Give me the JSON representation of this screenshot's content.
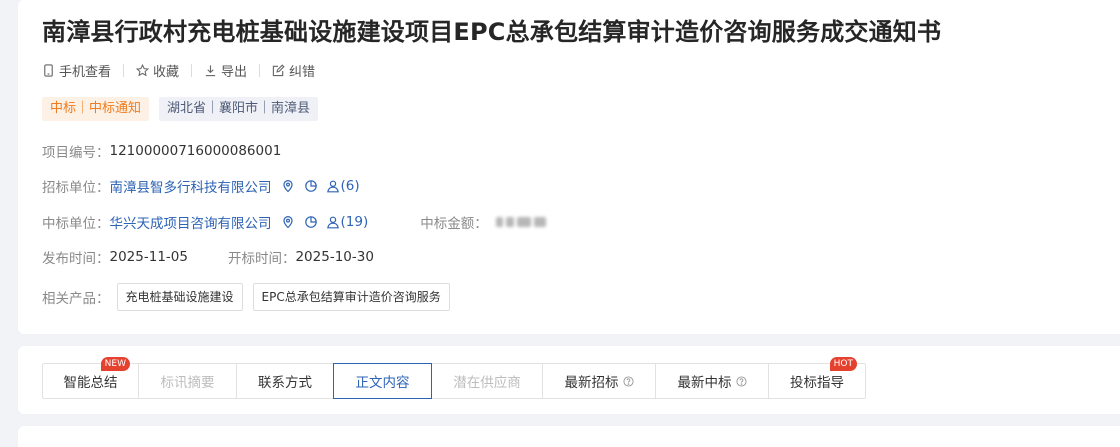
{
  "header": {
    "title": "南漳县行政村充电桩基础设施建设项目EPC总承包结算审计造价咨询服务成交通知书"
  },
  "actions": [
    {
      "label": "手机查看",
      "icon": "mobile-icon"
    },
    {
      "label": "收藏",
      "icon": "star-icon"
    },
    {
      "label": "导出",
      "icon": "download-icon"
    },
    {
      "label": "纠错",
      "icon": "edit-icon"
    }
  ],
  "tags": {
    "type": "中标｜中标通知",
    "region": "湖北省｜襄阳市｜南漳县"
  },
  "details": {
    "project_no_label": "项目编号：",
    "project_no": "12100000716000086001",
    "tenderer_label": "招标单位：",
    "tenderer": "南漳县智多行科技有限公司",
    "tenderer_contacts": "(6)",
    "winner_label": "中标单位：",
    "winner": "华兴天成项目咨询有限公司",
    "winner_contacts": "(19)",
    "amount_label": "中标金额：",
    "publish_label": "发布时间：",
    "publish_date": "2025-11-05",
    "open_label": "开标时间：",
    "open_date": "2025-10-30",
    "products_label": "相关产品：",
    "products": [
      "充电桩基础设施建设",
      "EPC总承包结算审计造价咨询服务"
    ]
  },
  "tabs": [
    {
      "label": "智能总结",
      "badge": "NEW"
    },
    {
      "label": "标讯摘要"
    },
    {
      "label": "联系方式"
    },
    {
      "label": "正文内容"
    },
    {
      "label": "潜在供应商"
    },
    {
      "label": "最新招标"
    },
    {
      "label": "最新中标"
    },
    {
      "label": "投标指导",
      "badge": "HOT"
    }
  ],
  "colors": {
    "link": "#2d63b5",
    "tag_orange": "#f07b1d",
    "badge": "#e5412f",
    "page_bg": "#f2f3f6"
  }
}
